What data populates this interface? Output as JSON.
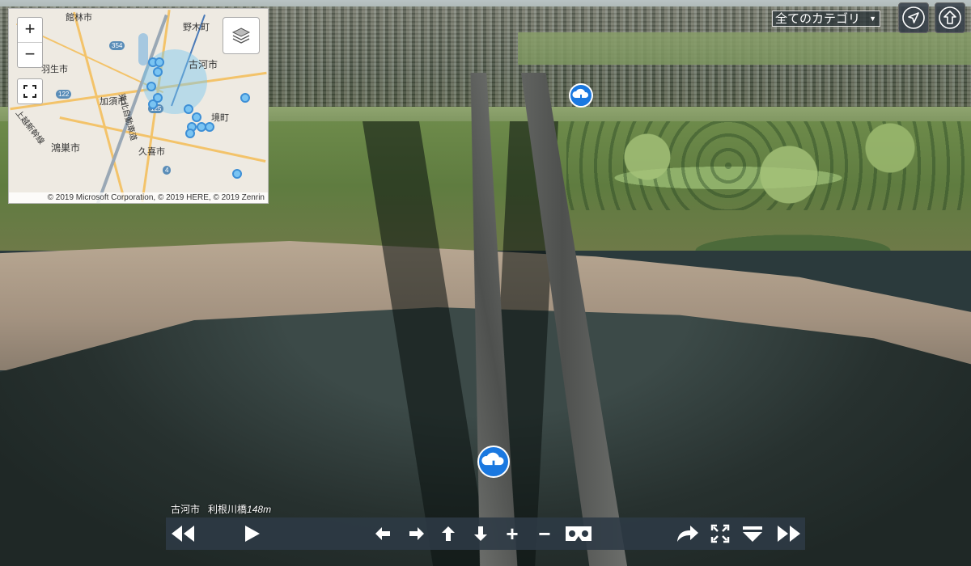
{
  "map": {
    "zoom_in_label": "+",
    "zoom_out_label": "−",
    "attribution": "© 2019 Microsoft Corporation, © 2019 HERE, © 2019 Zenrin",
    "place_labels": [
      "館林市",
      "野木町",
      "古河市",
      "羽生市",
      "加須市",
      "境町",
      "鴻巣市",
      "久喜市",
      "上越新幹線",
      "東北自動車道"
    ],
    "route_shields": [
      "354",
      "122",
      "125",
      "4"
    ],
    "icons": [
      "zoom-in-icon",
      "zoom-out-icon",
      "fullscreen-icon",
      "layers-icon",
      "location-pin-icon"
    ]
  },
  "top_controls": {
    "category_select": "全てのカテゴリ",
    "category_caret": "▼",
    "icons": [
      "navigation-arrow-icon",
      "upload-arrow-icon"
    ]
  },
  "hotspots": {
    "icons": [
      "cloud-download-icon",
      "cloud-download-icon"
    ]
  },
  "caption": {
    "place": "古河市",
    "landmark": "利根川橋",
    "distance": "148m"
  },
  "toolbar": {
    "icons": [
      "previous-icon",
      "play-icon",
      "pan-left-icon",
      "pan-right-icon",
      "pan-up-icon",
      "pan-down-icon",
      "zoom-in-icon",
      "zoom-out-icon",
      "vr-goggles-icon",
      "share-icon",
      "fullscreen-icon",
      "hide-toolbar-icon",
      "next-icon"
    ],
    "zoom_in_label": "+",
    "zoom_out_label": "−"
  },
  "colors": {
    "toolbar_bg": "#2d3a46",
    "hotspot_blue": "#1a78e0",
    "map_pin": "#7ac4f2"
  }
}
